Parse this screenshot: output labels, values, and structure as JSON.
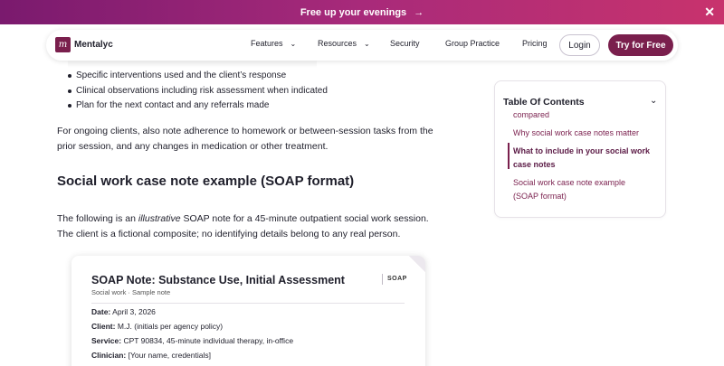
{
  "promo": {
    "text": "Free up your evenings",
    "arrow": "→",
    "close": "✕"
  },
  "nav": {
    "brand": "Mentalyc",
    "brand_mark": "m",
    "items": [
      {
        "label": "Features",
        "chevron": "⌄"
      },
      {
        "label": "Resources",
        "chevron": "⌄"
      },
      {
        "label": "Security"
      },
      {
        "label": "Group Practice"
      },
      {
        "label": "Pricing"
      }
    ],
    "login": "Login",
    "try": "Try for Free"
  },
  "article": {
    "bullets": [
      "Specific interventions used and the client’s response",
      "Clinical observations including risk assessment when indicated",
      "Plan for the next contact and any referrals made"
    ],
    "para1": "For ongoing clients, also note adherence to homework or between-session tasks from the prior session, and any changes in medication or other treatment.",
    "heading": "Social work case note example (SOAP format)",
    "para2_before": "The following is an ",
    "para2_em": "illustrative",
    "para2_after": " SOAP note for a 45-minute outpatient social work session. The client is a fictional composite; no identifying details belong to any real person."
  },
  "toc": {
    "title": "Table Of Contents",
    "chevron": "⌄",
    "items": [
      {
        "label": "compared"
      },
      {
        "label": "Why social work case notes matter"
      },
      {
        "label": "What to include in your social work case notes",
        "active": true
      },
      {
        "label": "Social work case note example (SOAP format)"
      }
    ]
  },
  "card": {
    "title": "SOAP Note: Substance Use, Initial Assessment",
    "subtitle": "Social work · Sample note",
    "tag": "SOAP",
    "fields": [
      {
        "label": "Date:",
        "value": "April 3, 2026"
      },
      {
        "label": "Client:",
        "value": "M.J. (initials per agency policy)"
      },
      {
        "label": "Service:",
        "value": "CPT 90834, 45-minute individual therapy, in-office"
      },
      {
        "label": "Clinician:",
        "value": "[Your name, credentials]"
      }
    ]
  },
  "colors": {
    "brand": "#7a1f4d",
    "promo_start": "#7a1a6e",
    "promo_end": "#c8336d"
  }
}
